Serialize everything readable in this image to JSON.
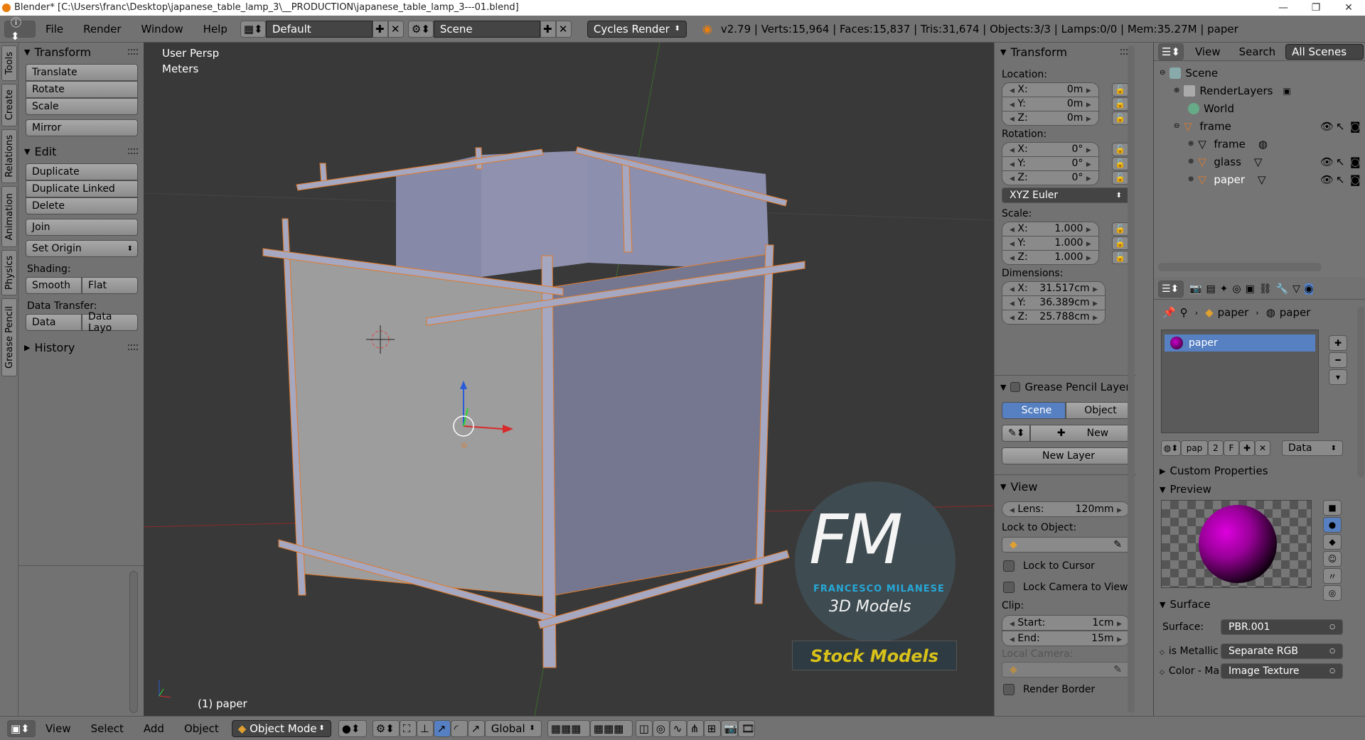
{
  "titlebar": {
    "title": "Blender* [C:\\Users\\franc\\Desktop\\japanese_table_lamp_3\\__PRODUCTION\\japanese_table_lamp_3---01.blend]",
    "min": "—",
    "max": "❐",
    "close": "✕"
  },
  "infobar": {
    "menus": [
      "File",
      "Render",
      "Window",
      "Help"
    ],
    "layout": "Default",
    "scene": "Scene",
    "engine": "Cycles Render",
    "stats": "v2.79 | Verts:15,964 | Faces:15,837 | Tris:31,674 | Objects:3/3 | Lamps:0/0 | Mem:35.27M | paper"
  },
  "tabs": [
    "Tools",
    "Create",
    "Relations",
    "Animation",
    "Physics",
    "Grease Pencil"
  ],
  "toolshelf": {
    "transform_title": "Transform",
    "transform_buttons": [
      "Translate",
      "Rotate",
      "Scale"
    ],
    "mirror": "Mirror",
    "edit_title": "Edit",
    "edit_buttons": [
      "Duplicate",
      "Duplicate Linked",
      "Delete"
    ],
    "join": "Join",
    "set_origin": "Set Origin",
    "shading_label": "Shading:",
    "smooth": "Smooth",
    "flat": "Flat",
    "data_transfer_label": "Data Transfer:",
    "data": "Data",
    "data_layout": "Data Layo",
    "history_title": "History"
  },
  "viewport": {
    "view_name": "User Persp",
    "units": "Meters",
    "object_label": "(1) paper",
    "watermark_initials": "FM",
    "watermark_name": "FRANCESCO MILANESE",
    "watermark_sub": "3D Models",
    "watermark_banner": "Stock Models"
  },
  "npanel": {
    "transform_title": "Transform",
    "location_label": "Location:",
    "location": [
      {
        "axis": "X:",
        "value": "0m"
      },
      {
        "axis": "Y:",
        "value": "0m"
      },
      {
        "axis": "Z:",
        "value": "0m"
      }
    ],
    "rotation_label": "Rotation:",
    "rotation": [
      {
        "axis": "X:",
        "value": "0°"
      },
      {
        "axis": "Y:",
        "value": "0°"
      },
      {
        "axis": "Z:",
        "value": "0°"
      }
    ],
    "rotation_mode": "XYZ Euler",
    "scale_label": "Scale:",
    "scale": [
      {
        "axis": "X:",
        "value": "1.000"
      },
      {
        "axis": "Y:",
        "value": "1.000"
      },
      {
        "axis": "Z:",
        "value": "1.000"
      }
    ],
    "dimensions_label": "Dimensions:",
    "dimensions": [
      {
        "axis": "X:",
        "value": "31.517cm"
      },
      {
        "axis": "Y:",
        "value": "36.389cm"
      },
      {
        "axis": "Z:",
        "value": "25.788cm"
      }
    ],
    "gp_title": "Grease Pencil Layer",
    "gp_scene": "Scene",
    "gp_object": "Object",
    "gp_new": "New",
    "gp_new_layer": "New Layer",
    "view_title": "View",
    "lens_label": "Lens:",
    "lens_value": "120mm",
    "lock_to_object": "Lock to Object:",
    "lock_to_cursor": "Lock to Cursor",
    "lock_camera": "Lock Camera to View",
    "clip_label": "Clip:",
    "clip_start_label": "Start:",
    "clip_start": "1cm",
    "clip_end_label": "End:",
    "clip_end": "15m",
    "local_camera": "Local Camera:",
    "render_border": "Render Border"
  },
  "outliner": {
    "view": "View",
    "search": "Search",
    "filter": "All Scenes",
    "items": [
      {
        "label": "Scene"
      },
      {
        "label": "RenderLayers"
      },
      {
        "label": "World"
      },
      {
        "label": "frame"
      },
      {
        "label": "frame"
      },
      {
        "label": "glass"
      },
      {
        "label": "paper"
      }
    ]
  },
  "properties": {
    "breadcrumb_object": "paper",
    "breadcrumb_material": "paper",
    "slot_name": "paper",
    "mat_name": "pap",
    "users": "2",
    "fake": "F",
    "link": "Data",
    "custom_props": "Custom Properties",
    "preview": "Preview",
    "surface_title": "Surface",
    "surface_label": "Surface:",
    "surface_value": "PBR.001",
    "metallic_label": "is Metallic",
    "metallic_value": "Separate RGB",
    "color_label": "Color - Ma",
    "color_value": "Image Texture"
  },
  "bottombar": {
    "view": "View",
    "select": "Select",
    "add": "Add",
    "object": "Object",
    "mode": "Object Mode",
    "orientation": "Global"
  }
}
